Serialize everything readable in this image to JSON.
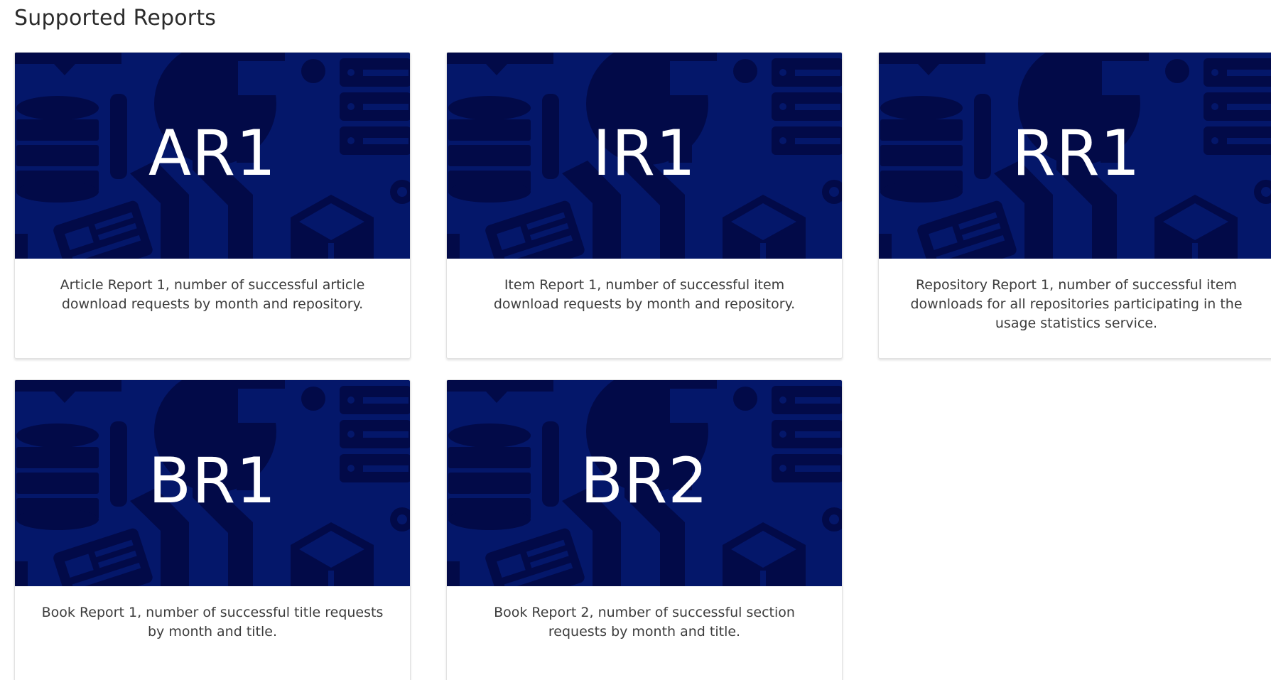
{
  "page": {
    "title": "Supported Reports"
  },
  "colors": {
    "banner_bg": "#04176a",
    "banner_shapes": "#020a48",
    "banner_text": "#ffffff"
  },
  "reports": [
    {
      "code": "AR1",
      "description": "Article Report 1, number of successful article download requests by month and repository."
    },
    {
      "code": "IR1",
      "description": "Item Report 1, number of successful item download requests by month and repository."
    },
    {
      "code": "RR1",
      "description": "Repository Report 1, number of successful item downloads for all repositories participating in the usage statistics service."
    },
    {
      "code": "BR1",
      "description": "Book Report 1, number of successful title requests by month and title."
    },
    {
      "code": "BR2",
      "description": "Book Report 2, number of successful section requests by month and title."
    }
  ]
}
